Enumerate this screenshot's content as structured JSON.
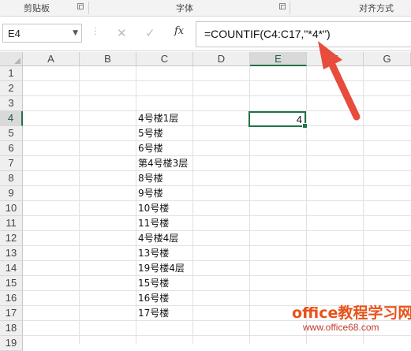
{
  "ribbon": {
    "groups": [
      "剪贴板",
      "字体",
      "对齐方式"
    ]
  },
  "formula_bar": {
    "name_box": "E4",
    "cancel_icon": "✕",
    "enter_icon": "✓",
    "fx_label": "fx",
    "formula": "=COUNTIF(C4:C17,\"*4*\")"
  },
  "sheet": {
    "columns": [
      "A",
      "B",
      "C",
      "D",
      "E",
      "F",
      "G"
    ],
    "rows": [
      "1",
      "2",
      "3",
      "4",
      "5",
      "6",
      "7",
      "8",
      "9",
      "10",
      "11",
      "12",
      "13",
      "14",
      "15",
      "16",
      "17",
      "18",
      "19"
    ],
    "selected_column": "E",
    "selected_row": "4",
    "column_c": [
      "4号楼1层",
      "5号楼",
      "6号楼",
      "第4号楼3层",
      "8号楼",
      "9号楼",
      "10号楼",
      "11号楼",
      "4号楼4层",
      "13号楼",
      "19号楼4层",
      "15号楼",
      "16号楼",
      "17号楼"
    ],
    "e4_value": "4"
  },
  "annotation": {
    "arrow_color": "#e74c3c"
  },
  "watermark": {
    "line1": "office教程学习网",
    "line2": "www.office68.com"
  },
  "colors": {
    "excel_green": "#217346"
  }
}
